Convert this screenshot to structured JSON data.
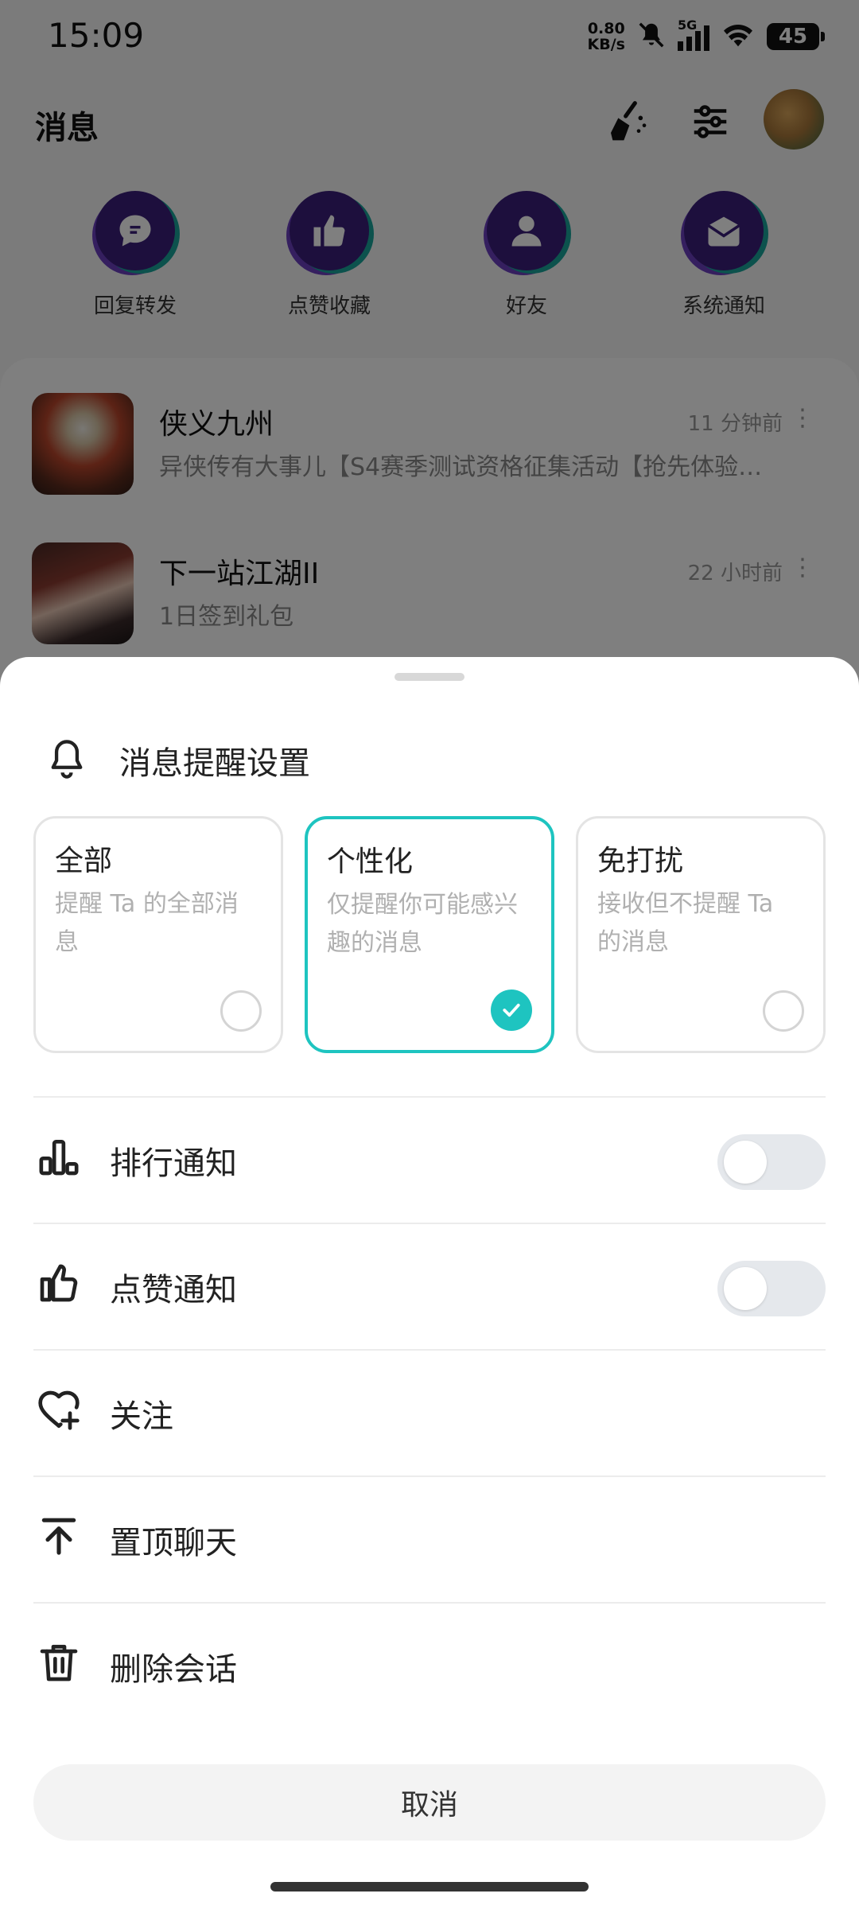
{
  "status_bar": {
    "time": "15:09",
    "net_speed_value": "0.80",
    "net_speed_unit": "KB/s",
    "signal_label": "5G",
    "battery": "45",
    "icons": [
      "mute-icon",
      "cellular-signal-icon",
      "wifi-icon",
      "battery-icon"
    ]
  },
  "header": {
    "title": "消息",
    "icons": [
      "clean-broom-icon",
      "settings-sliders-icon",
      "avatar"
    ]
  },
  "categories": [
    {
      "label": "回复转发",
      "icon": "chat-bubble-icon"
    },
    {
      "label": "点赞收藏",
      "icon": "thumbs-up-icon"
    },
    {
      "label": "好友",
      "icon": "person-icon"
    },
    {
      "label": "系统通知",
      "icon": "envelope-icon"
    }
  ],
  "messages": [
    {
      "name": "侠义九州",
      "time": "11 分钟前",
      "preview": "异侠传有大事儿【S4赛季测试资格征集活动【抢先体验…"
    },
    {
      "name": "下一站江湖II",
      "time": "22 小时前",
      "preview": "1日签到礼包"
    }
  ],
  "sheet": {
    "title": "消息提醒设置",
    "modes": [
      {
        "title": "全部",
        "desc": "提醒 Ta 的全部消息",
        "selected": false
      },
      {
        "title": "个性化",
        "desc": "仅提醒你可能感兴趣的消息",
        "selected": true
      },
      {
        "title": "免打扰",
        "desc": "接收但不提醒 Ta 的消息",
        "selected": false
      }
    ],
    "rows": [
      {
        "label": "排行通知",
        "icon": "ranking-bars-icon",
        "toggle": false
      },
      {
        "label": "点赞通知",
        "icon": "thumbs-up-outline-icon",
        "toggle": false
      },
      {
        "label": "关注",
        "icon": "heart-plus-icon"
      },
      {
        "label": "置顶聊天",
        "icon": "pin-to-top-icon"
      },
      {
        "label": "删除会话",
        "icon": "trash-icon"
      }
    ],
    "cancel": "取消"
  },
  "colors": {
    "accent": "#1ec4c0",
    "category_circle": "#3a1f7a",
    "category_ring": "#19a59b"
  }
}
